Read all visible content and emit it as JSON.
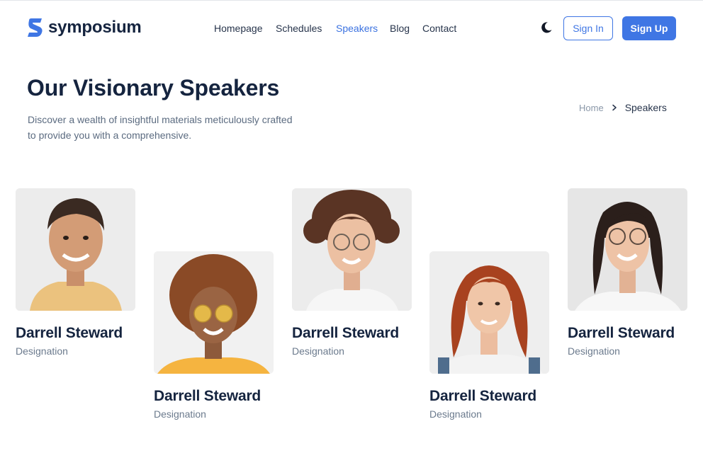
{
  "brand": {
    "name": "symposium",
    "logo_icon": "s-logo-icon",
    "color": "#3f76e4"
  },
  "nav": {
    "items": [
      {
        "label": "Homepage",
        "active": false
      },
      {
        "label": "Schedules",
        "active": false
      },
      {
        "label": "Speakers",
        "active": true
      },
      {
        "label": "Blog",
        "active": false
      },
      {
        "label": "Contact",
        "active": false
      }
    ]
  },
  "header": {
    "theme_toggle_icon": "moon-icon",
    "signin_label": "Sign In",
    "signup_label": "Sign Up"
  },
  "hero": {
    "title": "Our Visionary Speakers",
    "description": "Discover a wealth of insightful materials meticulously crafted to provide you with a comprehensive."
  },
  "breadcrumb": {
    "home": "Home",
    "separator_icon": "chevron-right-icon",
    "current": "Speakers"
  },
  "speakers": [
    {
      "name": "Darrell Steward",
      "designation": "Designation"
    },
    {
      "name": "Darrell Steward",
      "designation": "Designation"
    },
    {
      "name": "Darrell Steward",
      "designation": "Designation"
    },
    {
      "name": "Darrell Steward",
      "designation": "Designation"
    },
    {
      "name": "Darrell Steward",
      "designation": "Designation"
    }
  ],
  "colors": {
    "accent": "#3f76e4",
    "heading": "#15243f",
    "muted": "#5b6b80"
  }
}
